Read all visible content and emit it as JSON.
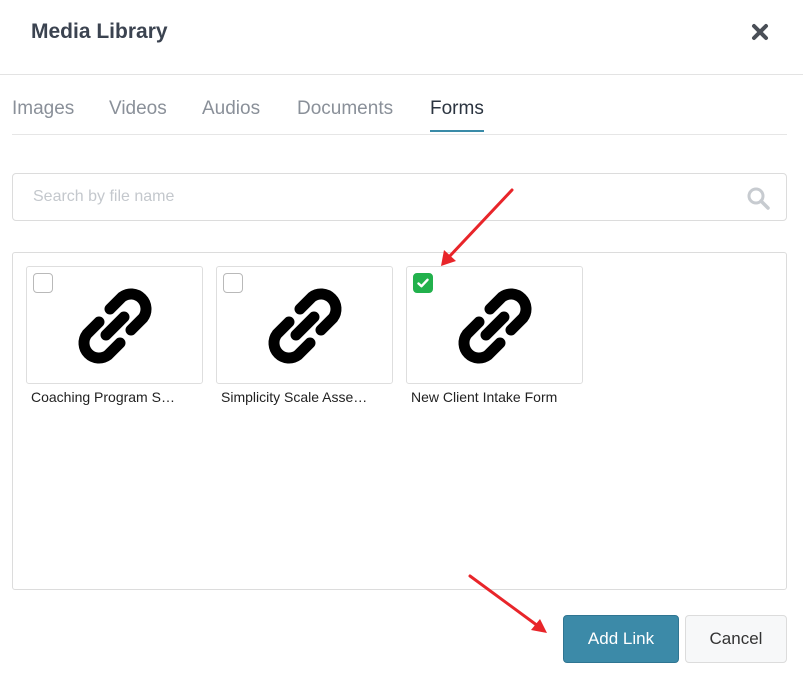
{
  "dialog": {
    "title": "Media Library"
  },
  "tabs": [
    {
      "label": "Images",
      "active": false
    },
    {
      "label": "Videos",
      "active": false
    },
    {
      "label": "Audios",
      "active": false
    },
    {
      "label": "Documents",
      "active": false
    },
    {
      "label": "Forms",
      "active": true
    }
  ],
  "search": {
    "placeholder": "Search by file name",
    "value": ""
  },
  "items": [
    {
      "name": "Coaching Program S…",
      "checked": false,
      "icon": "link-icon"
    },
    {
      "name": "Simplicity Scale Asse…",
      "checked": false,
      "icon": "link-icon"
    },
    {
      "name": "New Client Intake Form",
      "checked": true,
      "icon": "link-icon"
    }
  ],
  "footer": {
    "add_label": "Add Link",
    "cancel_label": "Cancel"
  },
  "colors": {
    "accent": "#3c8aa8",
    "checked": "#22b14c",
    "annotation_arrow": "#e8252a"
  }
}
